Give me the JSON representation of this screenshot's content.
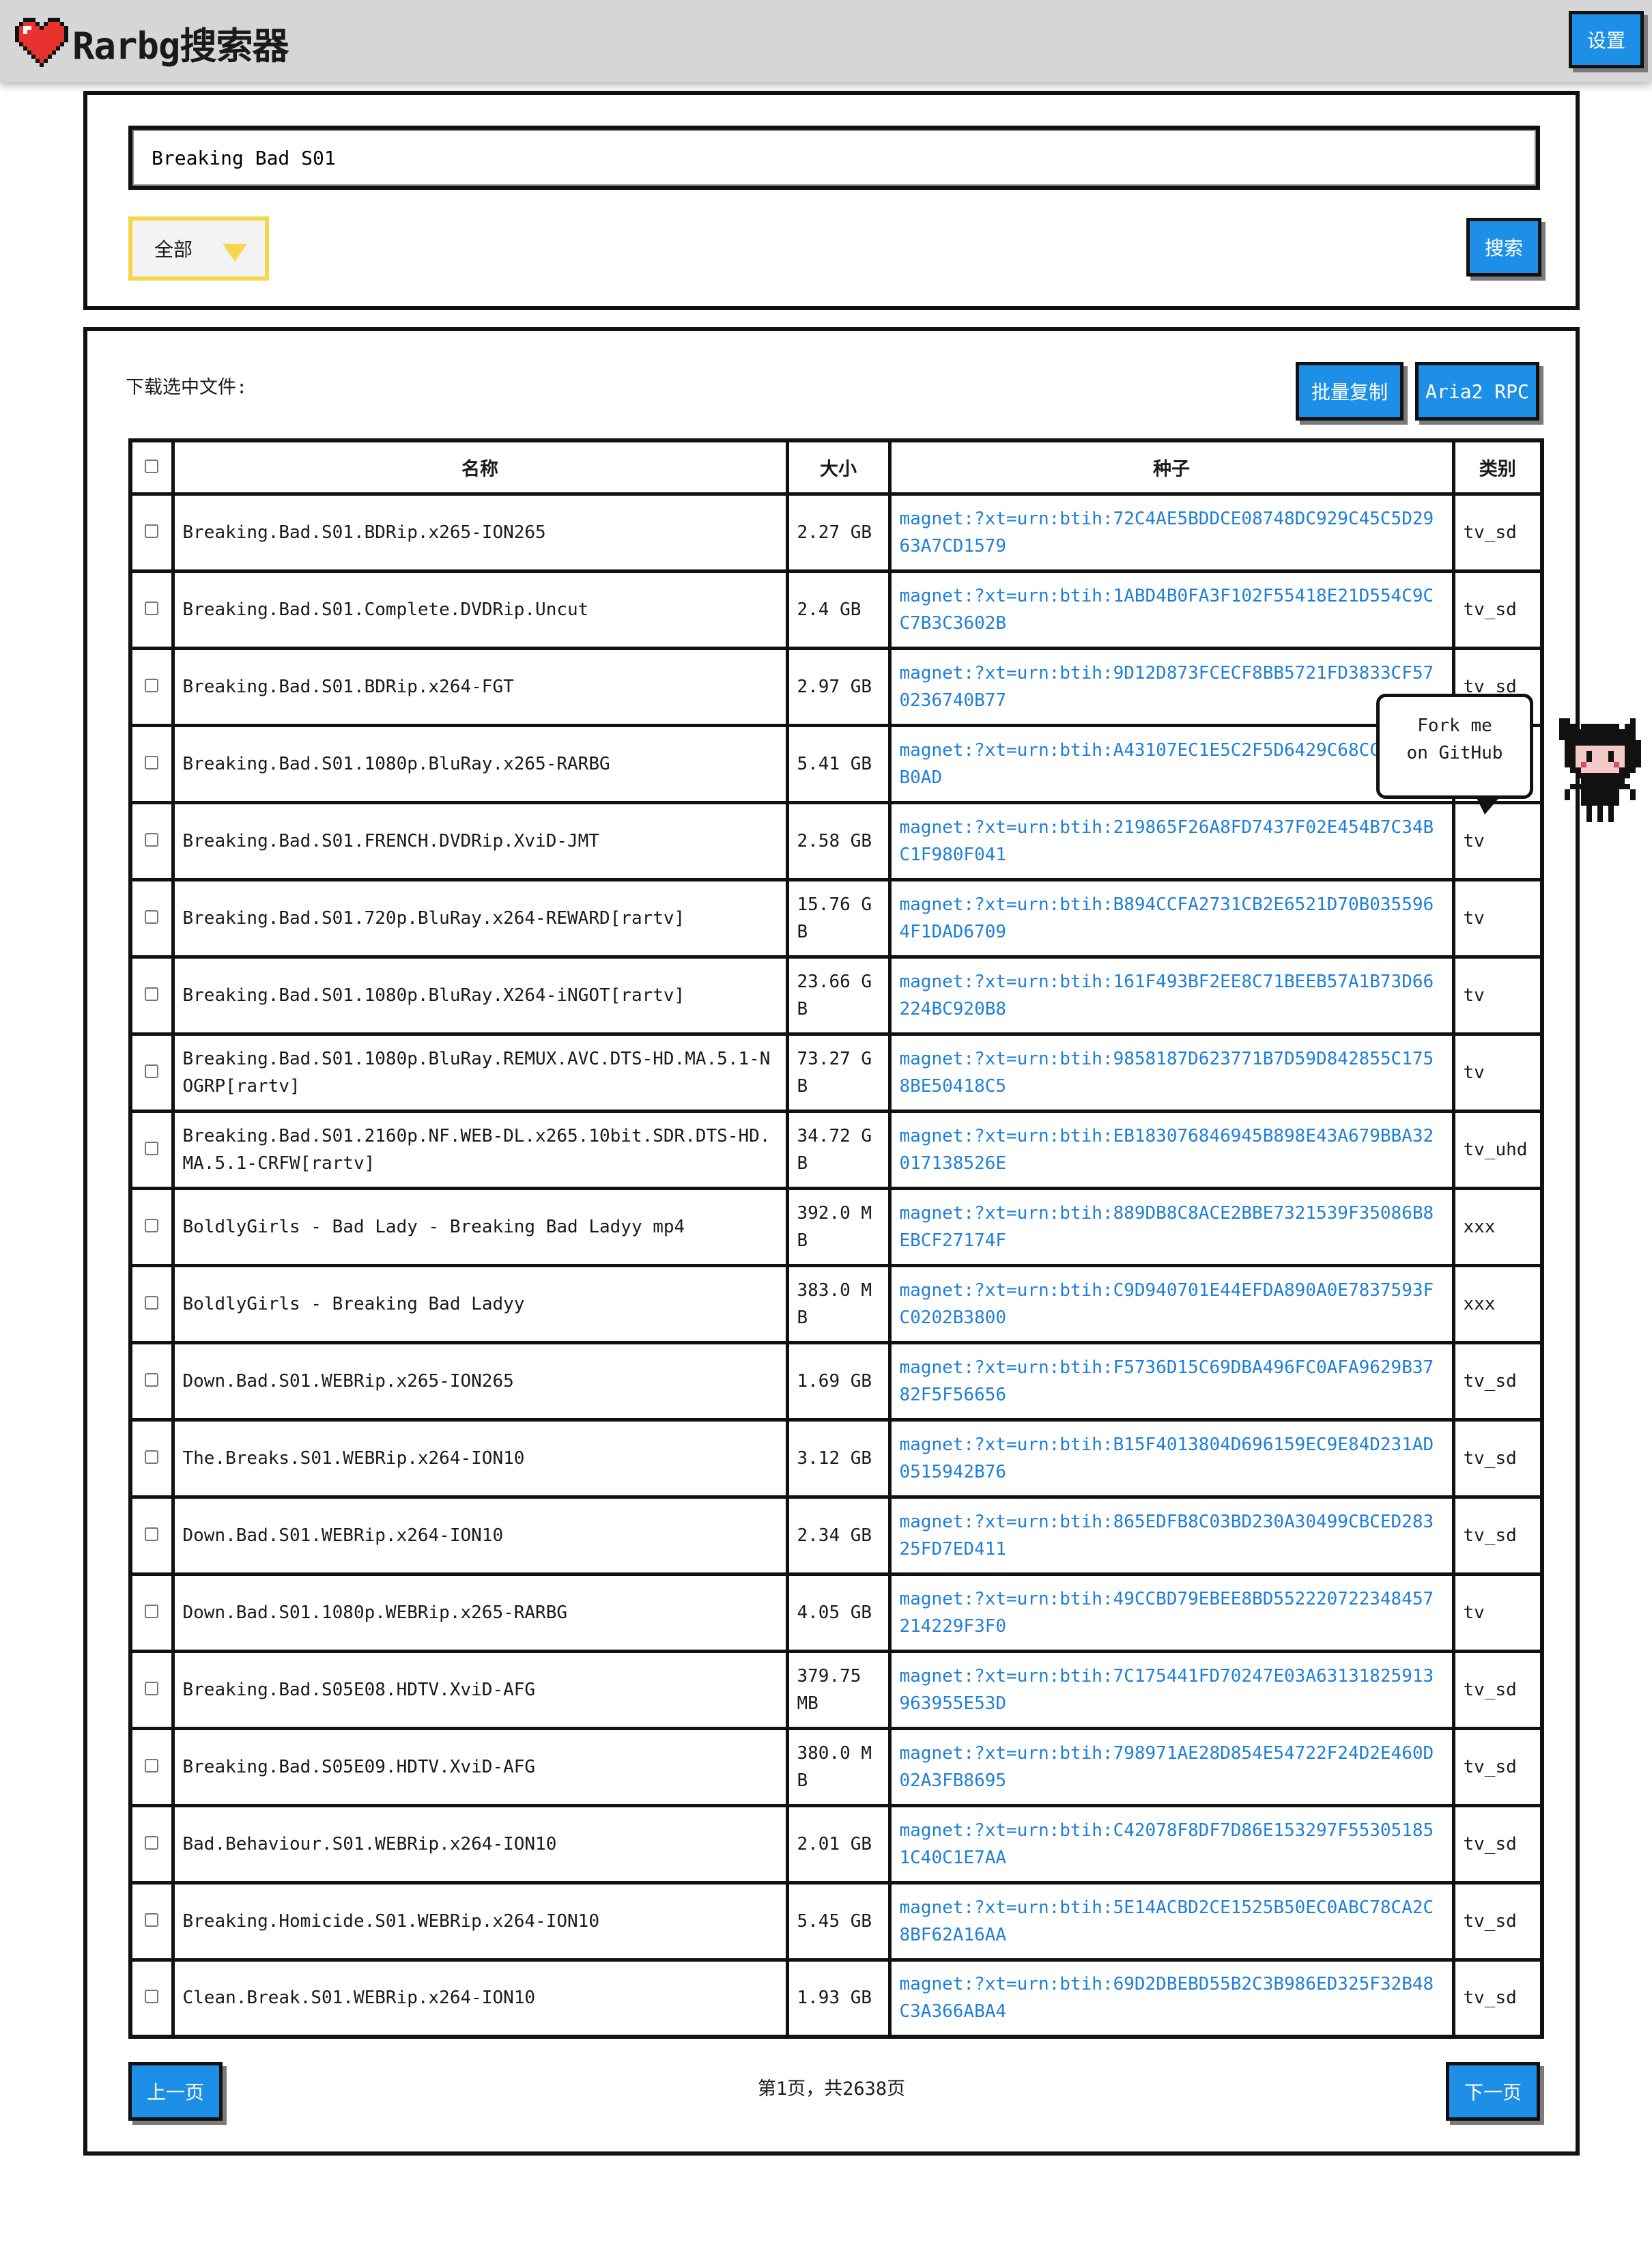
{
  "header": {
    "title": "Rarbg搜索器",
    "settings_label": "设置"
  },
  "search": {
    "query": "Breaking Bad S01",
    "category": "全部",
    "search_label": "搜索"
  },
  "results": {
    "download_label": "下载选中文件:",
    "batch_copy_label": "批量复制",
    "aria2_label": "Aria2 RPC",
    "columns": {
      "name": "名称",
      "size": "大小",
      "magnet": "种子",
      "category": "类别"
    },
    "rows": [
      {
        "name": "Breaking.Bad.S01.BDRip.x265-ION265",
        "size": "2.27 GB",
        "magnet": "magnet:?xt=urn:btih:72C4AE5BDDCE08748DC929C45C5D2963A7CD1579",
        "category": "tv_sd"
      },
      {
        "name": "Breaking.Bad.S01.Complete.DVDRip.Uncut",
        "size": "2.4 GB",
        "magnet": "magnet:?xt=urn:btih:1ABD4B0FA3F102F55418E21D554C9CC7B3C3602B",
        "category": "tv_sd"
      },
      {
        "name": "Breaking.Bad.S01.BDRip.x264-FGT",
        "size": "2.97 GB",
        "magnet": "magnet:?xt=urn:btih:9D12D873FCECF8BB5721FD3833CF570236740B77",
        "category": "tv_sd"
      },
      {
        "name": "Breaking.Bad.S01.1080p.BluRay.x265-RARBG",
        "size": "5.41 GB",
        "magnet": "magnet:?xt=urn:btih:A43107EC1E5C2F5D6429C68CC030BCB0AD",
        "category": "tv"
      },
      {
        "name": "Breaking.Bad.S01.FRENCH.DVDRip.XviD-JMT",
        "size": "2.58 GB",
        "magnet": "magnet:?xt=urn:btih:219865F26A8FD7437F02E454B7C34BC1F980F041",
        "category": "tv"
      },
      {
        "name": "Breaking.Bad.S01.720p.BluRay.x264-REWARD[rartv]",
        "size": "15.76 GB",
        "magnet": "magnet:?xt=urn:btih:B894CCFA2731CB2E6521D70B0355964F1DAD6709",
        "category": "tv"
      },
      {
        "name": "Breaking.Bad.S01.1080p.BluRay.X264-iNGOT[rartv]",
        "size": "23.66 GB",
        "magnet": "magnet:?xt=urn:btih:161F493BF2EE8C71BEEB57A1B73D66224BC920B8",
        "category": "tv"
      },
      {
        "name": "Breaking.Bad.S01.1080p.BluRay.REMUX.AVC.DTS-HD.MA.5.1-NOGRP[rartv]",
        "size": "73.27 GB",
        "magnet": "magnet:?xt=urn:btih:9858187D623771B7D59D842855C1758BE50418C5",
        "category": "tv"
      },
      {
        "name": "Breaking.Bad.S01.2160p.NF.WEB-DL.x265.10bit.SDR.DTS-HD.MA.5.1-CRFW[rartv]",
        "size": "34.72 GB",
        "magnet": "magnet:?xt=urn:btih:EB183076846945B898E43A679BBA32017138526E",
        "category": "tv_uhd"
      },
      {
        "name": "BoldlyGirls - Bad Lady - Breaking Bad Ladyy mp4",
        "size": "392.0 MB",
        "magnet": "magnet:?xt=urn:btih:889DB8C8ACE2BBE7321539F35086B8EBCF27174F",
        "category": "xxx"
      },
      {
        "name": "BoldlyGirls - Breaking Bad Ladyy",
        "size": "383.0 MB",
        "magnet": "magnet:?xt=urn:btih:C9D940701E44EFDA890A0E7837593FC0202B3800",
        "category": "xxx"
      },
      {
        "name": "Down.Bad.S01.WEBRip.x265-ION265",
        "size": "1.69 GB",
        "magnet": "magnet:?xt=urn:btih:F5736D15C69DBA496FC0AFA9629B3782F5F56656",
        "category": "tv_sd"
      },
      {
        "name": "The.Breaks.S01.WEBRip.x264-ION10",
        "size": "3.12 GB",
        "magnet": "magnet:?xt=urn:btih:B15F4013804D696159EC9E84D231AD0515942B76",
        "category": "tv_sd"
      },
      {
        "name": "Down.Bad.S01.WEBRip.x264-ION10",
        "size": "2.34 GB",
        "magnet": "magnet:?xt=urn:btih:865EDFB8C03BD230A30499CBCED28325FD7ED411",
        "category": "tv_sd"
      },
      {
        "name": "Down.Bad.S01.1080p.WEBRip.x265-RARBG",
        "size": "4.05 GB",
        "magnet": "magnet:?xt=urn:btih:49CCBD79EBEE8BD552220722348457214229F3F0",
        "category": "tv"
      },
      {
        "name": "Breaking.Bad.S05E08.HDTV.XviD-AFG",
        "size": "379.75 MB",
        "magnet": "magnet:?xt=urn:btih:7C175441FD70247E03A63131825913963955E53D",
        "category": "tv_sd"
      },
      {
        "name": "Breaking.Bad.S05E09.HDTV.XviD-AFG",
        "size": "380.0 MB",
        "magnet": "magnet:?xt=urn:btih:798971AE28D854E54722F24D2E460D02A3FB8695",
        "category": "tv_sd"
      },
      {
        "name": "Bad.Behaviour.S01.WEBRip.x264-ION10",
        "size": "2.01 GB",
        "magnet": "magnet:?xt=urn:btih:C42078F8DF7D86E153297F553051851C40C1E7AA",
        "category": "tv_sd"
      },
      {
        "name": "Breaking.Homicide.S01.WEBRip.x264-ION10",
        "size": "5.45 GB",
        "magnet": "magnet:?xt=urn:btih:5E14ACBD2CE1525B50EC0ABC78CA2C8BF62A16AA",
        "category": "tv_sd"
      },
      {
        "name": "Clean.Break.S01.WEBRip.x264-ION10",
        "size": "1.93 GB",
        "magnet": "magnet:?xt=urn:btih:69D2DBEBD55B2C3B986ED325F32B48C3A366ABA4",
        "category": "tv_sd"
      }
    ]
  },
  "pager": {
    "prev_label": "上一页",
    "info": "第1页，共2638页",
    "next_label": "下一页"
  },
  "fork": {
    "line1": "Fork me",
    "line2": "on GitHub"
  },
  "colors": {
    "accent": "#1e8fe6",
    "link": "#1f7fd6",
    "select_border": "#f4d84a",
    "header_bg": "#d6d6d6",
    "heart": "#e8322f"
  }
}
